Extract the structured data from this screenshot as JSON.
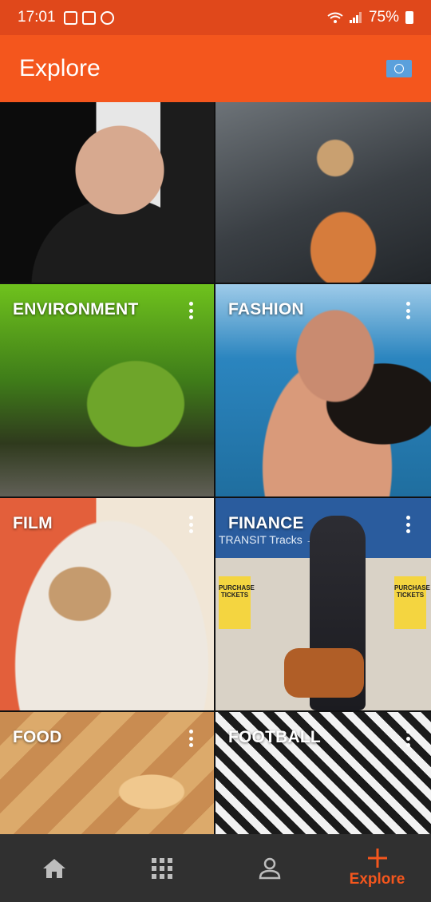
{
  "status_bar": {
    "time": "17:01",
    "battery": "75%"
  },
  "header": {
    "title": "Explore",
    "flag_icon": "un-flag-icon"
  },
  "colors": {
    "accent": "#f4561d",
    "status_bar": "#e0481b",
    "nav_background": "#303030",
    "nav_icon": "#bdbdbd"
  },
  "tiles": [
    {
      "label": ""
    },
    {
      "label": ""
    },
    {
      "label": "ENVIRONMENT"
    },
    {
      "label": "FASHION"
    },
    {
      "label": "FILM"
    },
    {
      "label": "FINANCE",
      "sign_text": "TRANSIT   Tracks   →   Elevator",
      "ticket_text": "PURCHASE TICKETS"
    },
    {
      "label": "FOOD"
    },
    {
      "label": "FOOTBALL"
    }
  ],
  "bottom_nav": {
    "items": [
      {
        "icon": "home-icon",
        "label": ""
      },
      {
        "icon": "grid-icon",
        "label": ""
      },
      {
        "icon": "profile-icon",
        "label": ""
      },
      {
        "icon": "plus-icon",
        "label": "Explore"
      }
    ]
  }
}
